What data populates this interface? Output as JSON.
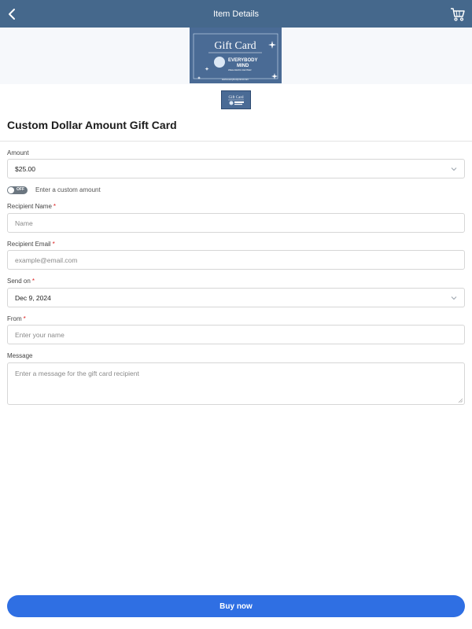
{
  "header": {
    "title": "Item Details",
    "back_icon": "chevron-left-icon",
    "cart_icon": "shopping-cart-icon",
    "bg_color": "#45688c"
  },
  "hero": {
    "card_title": "Gift Card",
    "brand_line1": "EVERYBODY",
    "brand_line2": "MIND",
    "brand_sub": "WELLNESS CENTER",
    "url": "www.everybodymind.com"
  },
  "product": {
    "title": "Custom Dollar Amount Gift Card"
  },
  "form": {
    "amount": {
      "label": "Amount",
      "value": "$25.00"
    },
    "custom_toggle": {
      "state": "OFF",
      "label": "Enter a custom amount"
    },
    "recipient_name": {
      "label": "Recipient Name",
      "placeholder": "Name"
    },
    "recipient_email": {
      "label": "Recipient Email",
      "placeholder": "example@email.com"
    },
    "send_on": {
      "label": "Send on",
      "value": "Dec 9, 2024"
    },
    "from": {
      "label": "From",
      "placeholder": "Enter your name"
    },
    "message": {
      "label": "Message",
      "placeholder": "Enter a message for the gift card recipient"
    },
    "required_mark": "*"
  },
  "footer": {
    "buy_label": "Buy now",
    "accent": "#2f6fe3"
  }
}
